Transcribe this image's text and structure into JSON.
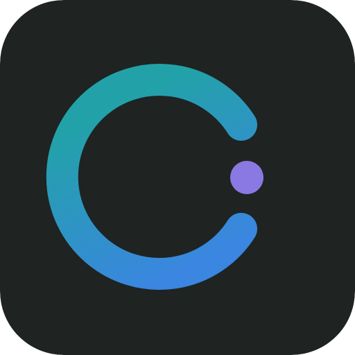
{
  "app_icon": {
    "icon": "power-ring-toggle-logo",
    "colors": {
      "background": "#1f2322",
      "gradient_start": "#22a2a8",
      "gradient_end": "#3a86e0",
      "accent_dot": "#8a79e2"
    }
  }
}
